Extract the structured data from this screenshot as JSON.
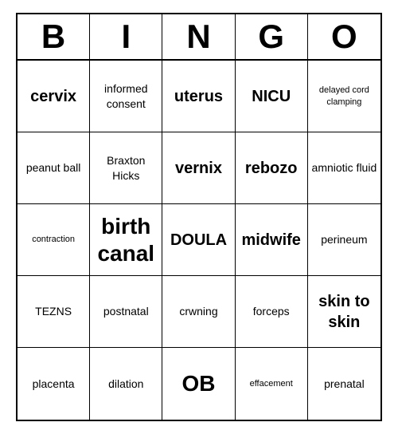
{
  "header": {
    "letters": [
      "B",
      "I",
      "N",
      "G",
      "O"
    ]
  },
  "cells": [
    {
      "text": "cervix",
      "size": "medium"
    },
    {
      "text": "informed consent",
      "size": "normal"
    },
    {
      "text": "uterus",
      "size": "medium"
    },
    {
      "text": "NICU",
      "size": "medium"
    },
    {
      "text": "delayed cord clamping",
      "size": "small"
    },
    {
      "text": "peanut ball",
      "size": "normal"
    },
    {
      "text": "Braxton Hicks",
      "size": "normal"
    },
    {
      "text": "vernix",
      "size": "medium"
    },
    {
      "text": "rebozo",
      "size": "medium"
    },
    {
      "text": "amniotic fluid",
      "size": "normal"
    },
    {
      "text": "contraction",
      "size": "small"
    },
    {
      "text": "birth canal",
      "size": "large"
    },
    {
      "text": "DOULA",
      "size": "medium"
    },
    {
      "text": "midwife",
      "size": "medium"
    },
    {
      "text": "perineum",
      "size": "normal"
    },
    {
      "text": "TEZNS",
      "size": "normal"
    },
    {
      "text": "postnatal",
      "size": "normal"
    },
    {
      "text": "crwning",
      "size": "normal"
    },
    {
      "text": "forceps",
      "size": "normal"
    },
    {
      "text": "skin to skin",
      "size": "medium"
    },
    {
      "text": "placenta",
      "size": "normal"
    },
    {
      "text": "dilation",
      "size": "normal"
    },
    {
      "text": "OB",
      "size": "large"
    },
    {
      "text": "effacement",
      "size": "small"
    },
    {
      "text": "prenatal",
      "size": "normal"
    }
  ]
}
